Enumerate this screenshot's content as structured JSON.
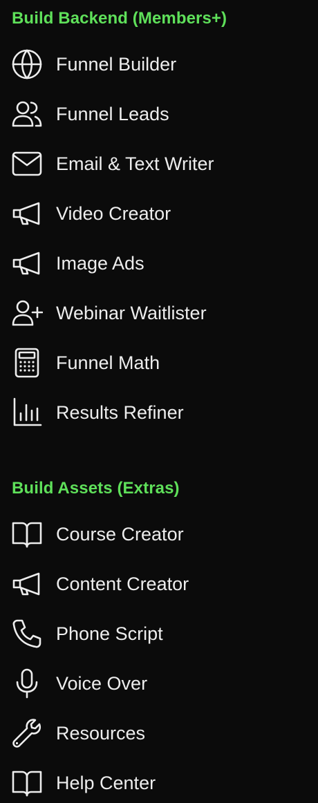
{
  "sections": [
    {
      "title": "Build Backend (Members+)",
      "items": [
        {
          "label": "Funnel Builder",
          "icon": "globe-icon"
        },
        {
          "label": "Funnel Leads",
          "icon": "users-icon"
        },
        {
          "label": "Email & Text Writer",
          "icon": "envelope-icon"
        },
        {
          "label": "Video Creator",
          "icon": "megaphone-icon"
        },
        {
          "label": "Image Ads",
          "icon": "megaphone-icon"
        },
        {
          "label": "Webinar Waitlister",
          "icon": "user-plus-icon"
        },
        {
          "label": "Funnel Math",
          "icon": "calculator-icon"
        },
        {
          "label": "Results Refiner",
          "icon": "bar-chart-icon"
        }
      ]
    },
    {
      "title": "Build Assets (Extras)",
      "items": [
        {
          "label": "Course Creator",
          "icon": "book-open-icon"
        },
        {
          "label": "Content Creator",
          "icon": "megaphone-icon"
        },
        {
          "label": "Phone Script",
          "icon": "phone-icon"
        },
        {
          "label": "Voice Over",
          "icon": "microphone-icon"
        },
        {
          "label": "Resources",
          "icon": "wrench-icon"
        },
        {
          "label": "Help Center",
          "icon": "book-open-icon"
        }
      ]
    }
  ],
  "colors": {
    "background": "#0b0b0b",
    "section_title": "#5fe05a",
    "item_text": "#ededed"
  }
}
